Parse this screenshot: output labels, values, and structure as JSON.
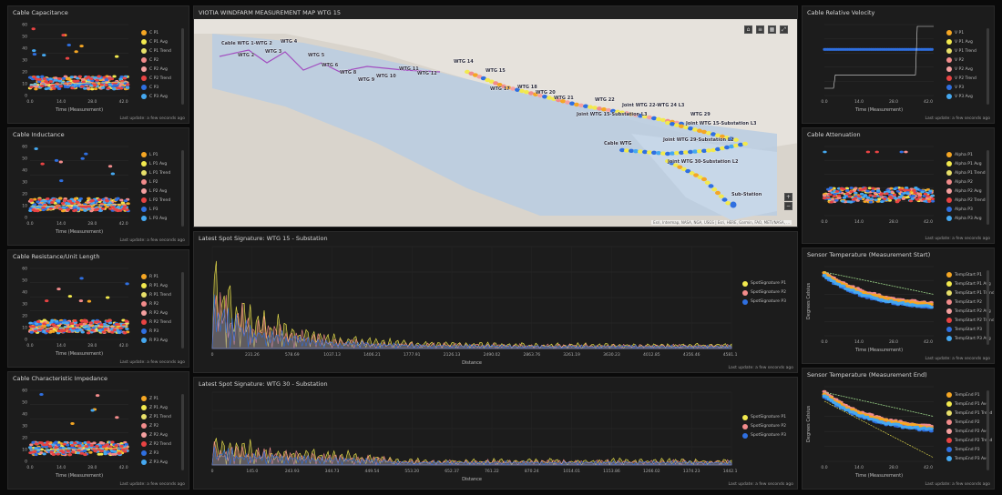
{
  "map": {
    "title": "VIOTIA WINDFARM MEASUREMENT MAP WTG 15",
    "attribution": "Esri, Intermap, NASA, NGA, USGS | Esri, HERE, Garmin, FAO, METI/NASA, ...",
    "labels": [
      "Cable WTG 1-WTG 2",
      "WTG 2",
      "WTG 3",
      "WTG 4",
      "WTG 5",
      "WTG 6",
      "WTG 8",
      "WTG 9",
      "WTG 10",
      "WTG 11",
      "WTG 12",
      "WTG 14",
      "WTG 15",
      "WTG 17",
      "WTG 18",
      "WTG 20",
      "WTG 21",
      "WTG 22",
      "Joint WTG 15-Substation L3",
      "Joint WTG 22-WTG 24 L3",
      "WTG 29",
      "Joint WTG 15-Substation L3",
      "Joint WTG 29-Substation L2",
      "Cable WTG",
      "Joint WTG 30-Substation L2",
      "Sub-Station"
    ],
    "icons": [
      "home-icon",
      "layers-icon",
      "basemap-icon",
      "fullscreen-icon"
    ],
    "zoom_in": "+",
    "zoom_out": "−"
  },
  "left_panels": [
    {
      "title": "Cable Capacitance",
      "xlabel": "Time (Measurement)",
      "footer": "Last update: a few seconds ago",
      "xticks": [
        "0.0",
        "14.0",
        "28.0",
        "42.0"
      ],
      "yticks": [
        "0",
        "10",
        "20",
        "30",
        "40",
        "50",
        "60"
      ],
      "legend": [
        "C P1",
        "C P1 Avg",
        "C P1 Trend",
        "C P2",
        "C P2 Avg",
        "C P2 Trend",
        "C P3",
        "C P3 Avg"
      ]
    },
    {
      "title": "Cable Inductance",
      "xlabel": "Time (Measurement)",
      "footer": "Last update: a few seconds ago",
      "xticks": [
        "0.0",
        "14.0",
        "28.0",
        "42.0"
      ],
      "yticks": [
        "0",
        "10",
        "20",
        "30",
        "40",
        "50",
        "60"
      ],
      "legend": [
        "L P1",
        "L P1 Avg",
        "L P1 Trend",
        "L P2",
        "L P2 Avg",
        "L P2 Trend",
        "L P3",
        "L P3 Avg"
      ]
    },
    {
      "title": "Cable Resistance/Unit Length",
      "xlabel": "Time (Measurement)",
      "footer": "Last update: a few seconds ago",
      "xticks": [
        "0.0",
        "14.0",
        "28.0",
        "42.0"
      ],
      "yticks": [
        "0",
        "10",
        "20",
        "30",
        "40",
        "50",
        "60"
      ],
      "legend": [
        "R P1",
        "R P1 Avg",
        "R P1 Trend",
        "R P2",
        "R P2 Avg",
        "R P2 Trend",
        "R P3",
        "R P3 Avg"
      ]
    },
    {
      "title": "Cable Characteristic Impedance",
      "xlabel": "Time (Measurement)",
      "footer": "Last update: a few seconds ago",
      "xticks": [
        "0.0",
        "14.0",
        "28.0",
        "42.0"
      ],
      "yticks": [
        "0",
        "10",
        "20",
        "30",
        "40",
        "50",
        "60"
      ],
      "legend": [
        "Z P1",
        "Z P1 Avg",
        "Z P1 Trend",
        "Z P2",
        "Z P2 Avg",
        "Z P2 Trend",
        "Z P3",
        "Z P3 Avg"
      ]
    }
  ],
  "right_panels": [
    {
      "title": "Cable Relative Velocity",
      "xlabel": "Time (Measurement)",
      "footer": "Last update: a few seconds ago",
      "xticks": [
        "0.0",
        "14.0",
        "28.0",
        "42.0"
      ],
      "yticks": [
        "",
        "",
        "",
        "",
        ""
      ],
      "legend": [
        "V P1",
        "V P1 Avg",
        "V P1 Trend",
        "V P2",
        "V P2 Avg",
        "V P2 Trend",
        "V P3",
        "V P3 Avg"
      ]
    },
    {
      "title": "Cable Attenuation",
      "xlabel": "",
      "footer": "Last update: a few seconds ago",
      "xticks": [
        "0.0",
        "14.0",
        "28.0",
        "42.0"
      ],
      "yticks": [
        "",
        "",
        "",
        "",
        ""
      ],
      "legend": [
        "Alpha P1",
        "Alpha P1 Avg",
        "Alpha P1 Trend",
        "Alpha P2",
        "Alpha P2 Avg",
        "Alpha P2 Trend",
        "Alpha P3",
        "Alpha P3 Avg"
      ]
    },
    {
      "title": "Sensor Temperature (Measurement Start)",
      "xlabel": "Time (Measurement)",
      "ylabel": "Degrees Celsius",
      "footer": "Last update: a few seconds ago",
      "xticks": [
        "0.0",
        "14.0",
        "28.0",
        "42.0"
      ],
      "yticks": [
        "",
        "",
        "",
        "",
        ""
      ],
      "legend": [
        "TempStart P1",
        "TempStart P1 Avg",
        "TempStart P1 Trend",
        "TempStart P2",
        "TempStart P2 Avg",
        "TempStart P2 Trend",
        "TempStart P3",
        "TempStart P3 Avg"
      ]
    },
    {
      "title": "Sensor Temperature (Measurement End)",
      "xlabel": "Time (Measurement)",
      "ylabel": "Degrees Celsius",
      "footer": "Last update: a few seconds ago",
      "xticks": [
        "0.0",
        "14.0",
        "28.0",
        "42.0"
      ],
      "yticks": [
        "",
        "",
        "",
        "",
        ""
      ],
      "legend": [
        "TempEnd P1",
        "TempEnd P1 Avg",
        "TempEnd P1 Trend",
        "TempEnd P2",
        "TempEnd P2 Avg",
        "TempEnd P2 Trend",
        "TempEnd P3",
        "TempEnd P3 Avg"
      ]
    }
  ],
  "spot_panels": [
    {
      "title": "Latest Spot Signature: WTG 15 - Substation",
      "xlabel": "Distance",
      "footer": "Last update: a few seconds ago",
      "xticks": [
        "0",
        "231.26",
        "578.69",
        "1037.13",
        "1406.21",
        "1777.91",
        "2126.13",
        "2490.02",
        "2863.76",
        "3261.19",
        "3630.23",
        "4012.85",
        "4356.46",
        "4581.11"
      ],
      "legend": [
        "SpotSignature P1",
        "SpotSignature P2",
        "SpotSignature P3"
      ]
    },
    {
      "title": "Latest Spot Signature: WTG 30 - Substation",
      "xlabel": "Distance",
      "footer": "Last update: a few seconds ago",
      "xticks": [
        "0",
        "145.0",
        "243.93",
        "344.73",
        "449.54",
        "553.20",
        "652.37",
        "761.22",
        "870.24",
        "1014.01",
        "1153.86",
        "1266.02",
        "1374.23",
        "1442.13"
      ],
      "legend": [
        "SpotSignature P1",
        "SpotSignature P2",
        "SpotSignature P3"
      ]
    }
  ],
  "colors": {
    "yellow": "#f2e94e",
    "orange": "#f5a623",
    "lightyellow": "#e8e06a",
    "pink": "#f28b8b",
    "salmon": "#f4a0a0",
    "red": "#e84343",
    "blue": "#2f6fe0",
    "lightblue": "#45a8f0",
    "green": "#9fdb8c",
    "purple": "#a24dc0"
  }
}
